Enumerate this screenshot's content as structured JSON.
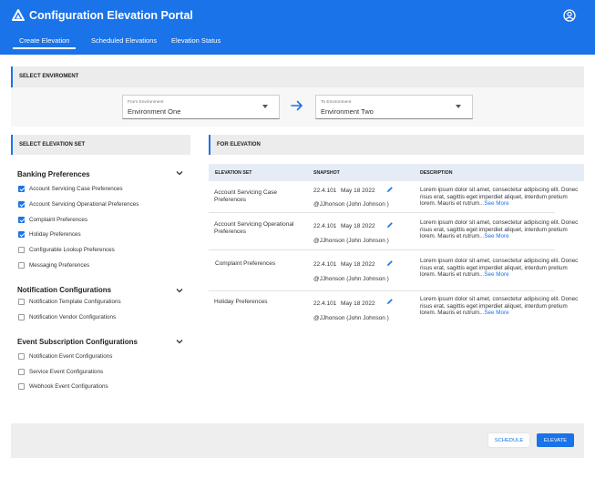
{
  "app": {
    "title": "Configuration Elevation Portal"
  },
  "colors": {
    "primary": "#1a73e8",
    "header_bg": "#1a73e8",
    "panel_bg": "#ececec"
  },
  "icons": {
    "logo": "triangle-logo-icon",
    "profile": "account-circle-icon",
    "arrow": "arrow-right-icon",
    "edit": "pencil-icon",
    "chevron": "chevron-down-icon"
  },
  "tabs": [
    {
      "label": "Create Elevation",
      "active": true
    },
    {
      "label": "Scheduled Elevations",
      "active": false
    },
    {
      "label": "Elevation Status",
      "active": false
    }
  ],
  "environment": {
    "heading": "SELECT ENVIROMENT",
    "from": {
      "small_label": "From Environment",
      "value": "Environment One"
    },
    "to": {
      "small_label": "To Environment",
      "value": "Environment Two"
    }
  },
  "select_set": {
    "heading": "SELECT ELEVATION SET",
    "groups": [
      {
        "title": "Banking Preferences",
        "items": [
          {
            "label": "Account Servicing Case Preferences",
            "checked": true
          },
          {
            "label": "Account Servicing Operational Preferences",
            "checked": true
          },
          {
            "label": "Complaint Preferences",
            "checked": true
          },
          {
            "label": "Holiday Preferences",
            "checked": true
          },
          {
            "label": "Configurable Lookup Preferences",
            "checked": false
          },
          {
            "label": "Messaging Preferences",
            "checked": false
          }
        ]
      },
      {
        "title": "Notification Configurations",
        "items": [
          {
            "label": "Notification Template Configurations",
            "checked": false
          },
          {
            "label": "Notification Vendor Configurations",
            "checked": false
          }
        ]
      },
      {
        "title": "Event Subscription Configurations",
        "items": [
          {
            "label": "Notification Event Configurations",
            "checked": false
          },
          {
            "label": "Service Event Configurations",
            "checked": false
          },
          {
            "label": "Webhook Event Configurations",
            "checked": false
          }
        ]
      }
    ]
  },
  "for_elevation": {
    "heading": "FOR ELEVATION",
    "columns": [
      "ELEVATION SET",
      "SNAPSHOT",
      "DESCRIPTION"
    ],
    "rows": [
      {
        "set": "Account Servicing Case Preferences",
        "version": "22.4.101",
        "date": "May 18 2022",
        "user": "@JJhonson (John Johnson )",
        "description": "Lorem ipsum dolor sit amet, consectetur adipiscing elit. Donec risus erat, sagittis eget imperdiet aliquet, interdum pretium lorem. Mauris et rutrum.",
        "see_more": "..See More"
      },
      {
        "set": "Account Servicing Operational Preferences",
        "version": "22.4.101",
        "date": "May 18 2022",
        "user": "@JJhonson (John Johnson )",
        "description": "Lorem ipsum dolor sit amet, consectetur adipiscing elit. Donec risus erat, sagittis eget imperdiet aliquet, interdum pretium lorem. Mauris et rutrum.",
        "see_more": "..See More"
      },
      {
        "set": "Complaint Preferences",
        "version": "22.4.101",
        "date": "May 18 2022",
        "user": "@JJhonson (John Johnson )",
        "description": "Lorem ipsum dolor sit amet, consectetur adipiscing elit. Donec risus erat, sagittis eget imperdiet aliquet, interdum pretium lorem. Mauris et rutrum.",
        "see_more": "..See More"
      },
      {
        "set": "Holiday Preferences",
        "version": "22.4.101",
        "date": "May 18 2022",
        "user": "@JJhonson (John Johnson )",
        "description": "Lorem ipsum dolor sit amet, consectetur adipiscing elit. Donec risus erat, sagittis eget imperdiet aliquet, interdum pretium lorem. Mauris et rutrum.",
        "see_more": "..See More"
      }
    ]
  },
  "footer": {
    "schedule_label": "SCHEDULE",
    "elevate_label": "ELEVATE"
  }
}
